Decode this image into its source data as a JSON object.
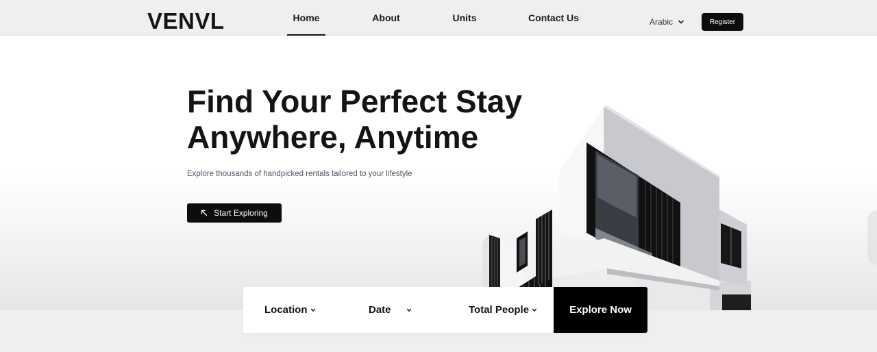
{
  "brand": {
    "logo": "VENVL"
  },
  "nav": {
    "links": [
      {
        "label": "Home",
        "active": true
      },
      {
        "label": "About",
        "active": false
      },
      {
        "label": "Units",
        "active": false
      },
      {
        "label": "Contact Us",
        "active": false
      }
    ],
    "language": "Arabic",
    "register_label": "Register"
  },
  "hero": {
    "title_line1": "Find Your Perfect Stay",
    "title_line2": "Anywhere, Anytime",
    "subtitle": "Explore thousands of handpicked rentals tailored to your lifestyle",
    "cta_label": "Start Exploring",
    "cta_icon": "arrow-up-left-icon",
    "image": "modern-house-illustration"
  },
  "search": {
    "location_label": "Location",
    "date_label": "Date",
    "people_label": "Total People",
    "submit_label": "Explore Now"
  },
  "colors": {
    "primary": "#0d0d0d",
    "text": "#141414",
    "muted": "#4e5666",
    "background": "#efefef",
    "surface": "#ffffff"
  }
}
